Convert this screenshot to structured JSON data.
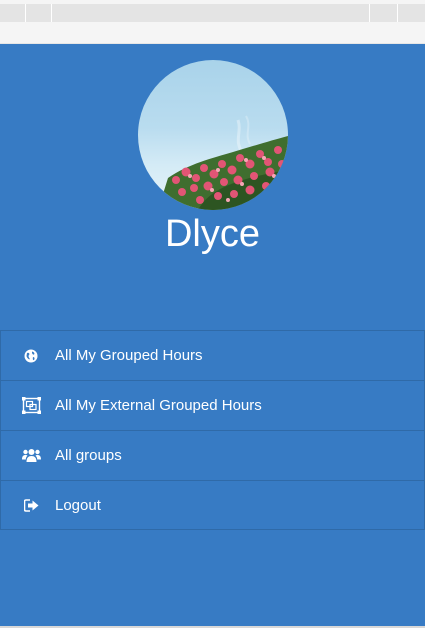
{
  "profile": {
    "name": "Dlyce",
    "avatar_icon": "rose-bush-avatar"
  },
  "menu": {
    "items": [
      {
        "label": "All My Grouped Hours",
        "icon": "globe-icon"
      },
      {
        "label": "All My External Grouped Hours",
        "icon": "object-group-icon"
      },
      {
        "label": "All groups",
        "icon": "users-icon"
      },
      {
        "label": "Logout",
        "icon": "sign-out-icon"
      }
    ]
  },
  "colors": {
    "drawer_background": "#377bc4",
    "divider": "#2f6aa8",
    "text": "#ffffff"
  }
}
